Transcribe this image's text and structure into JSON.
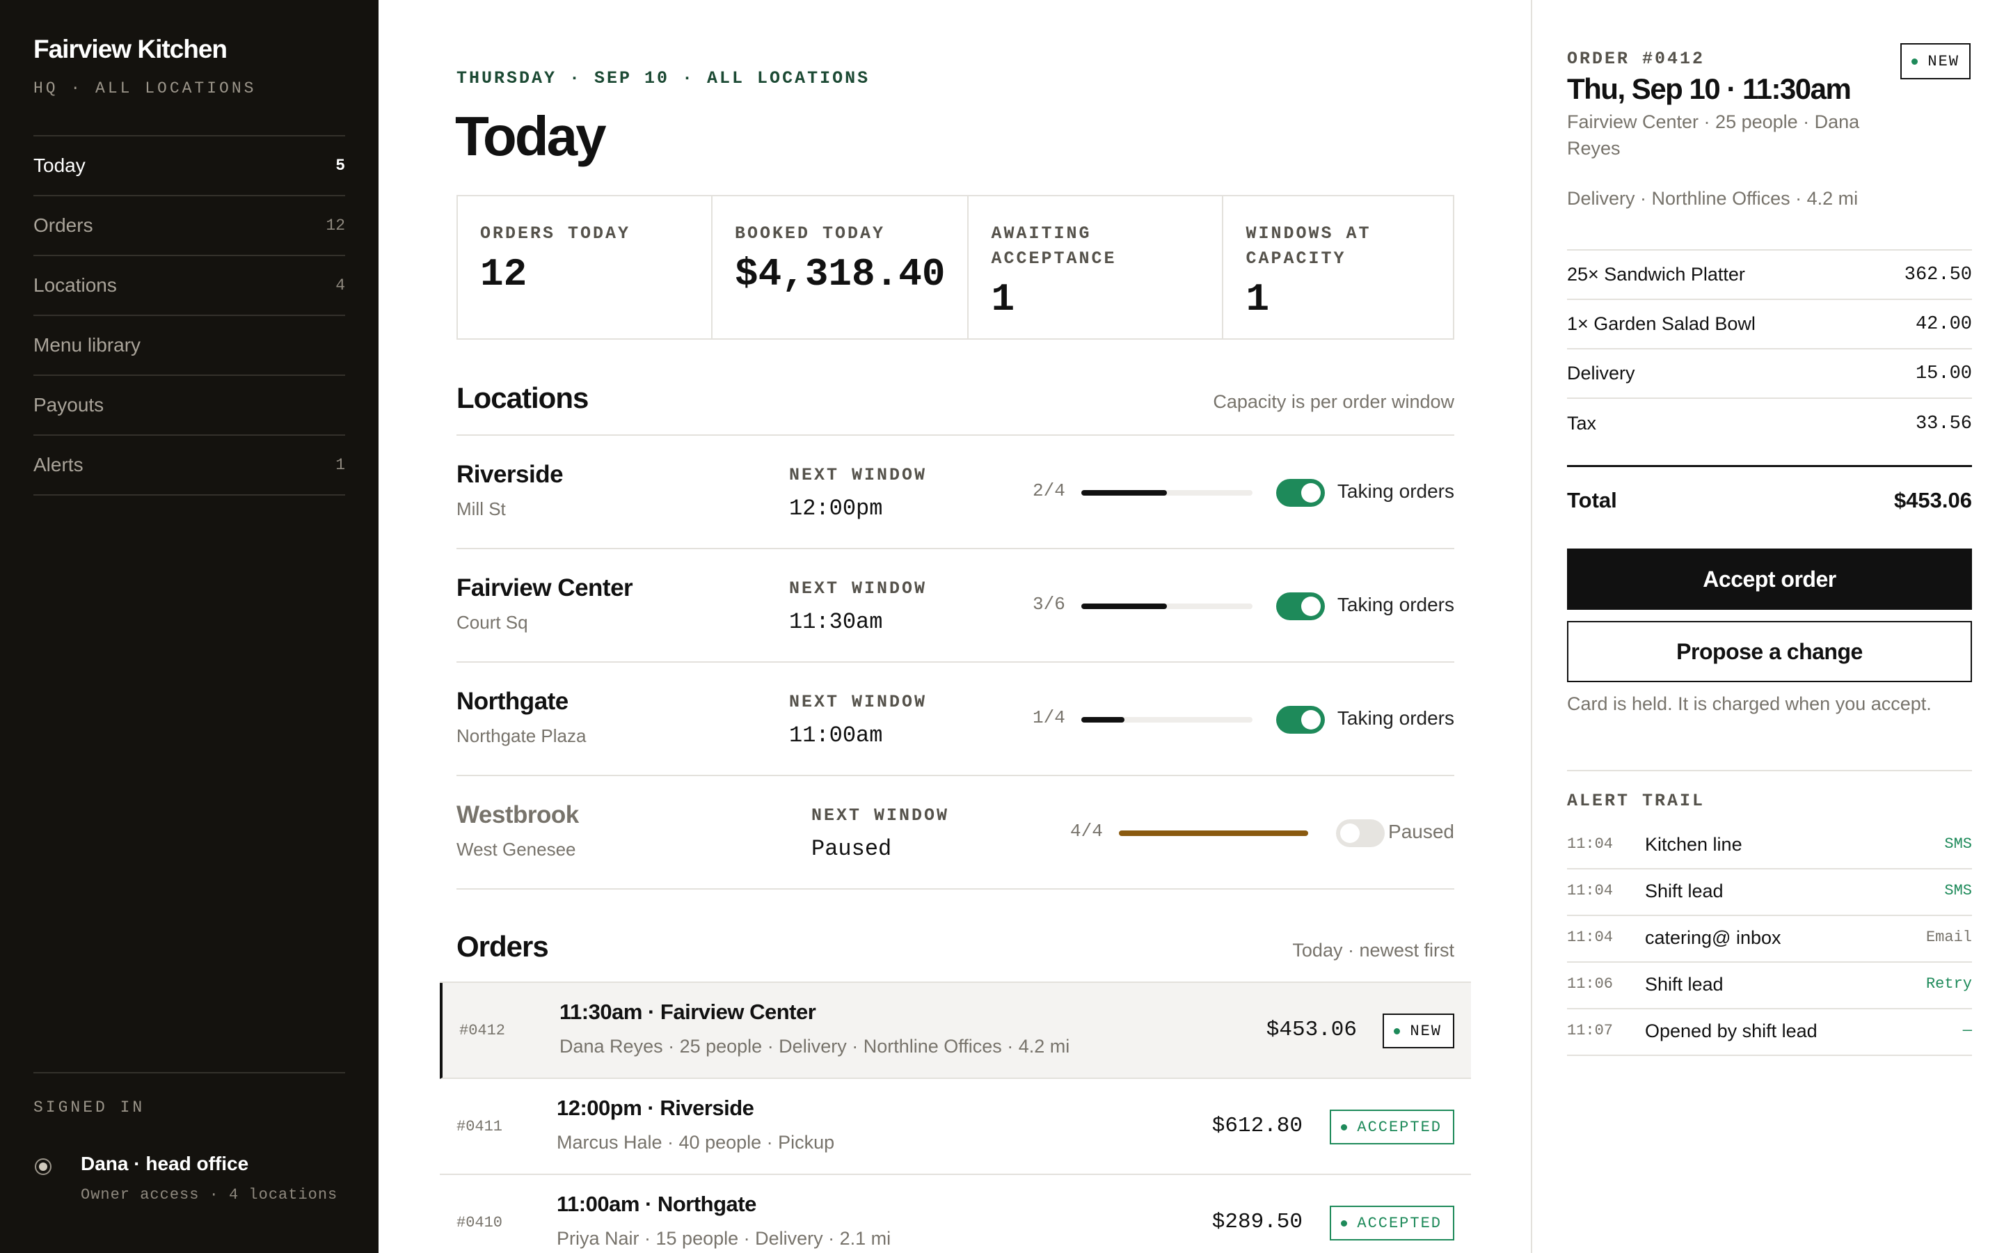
{
  "sidebar": {
    "brand": "Fairview Kitchen",
    "subtitle": "HQ · ALL LOCATIONS",
    "nav": [
      {
        "label": "Today",
        "count": "5"
      },
      {
        "label": "Orders",
        "count": "12"
      },
      {
        "label": "Locations",
        "count": "4"
      },
      {
        "label": "Menu library",
        "count": ""
      },
      {
        "label": "Payouts",
        "count": ""
      },
      {
        "label": "Alerts",
        "count": "1"
      }
    ],
    "signed_in_label": "SIGNED IN",
    "user_name": "Dana · head office",
    "user_sub": "Owner access · 4 locations"
  },
  "main": {
    "eyebrow": "THURSDAY · SEP 10 · ALL LOCATIONS",
    "title": "Today",
    "stats": [
      {
        "label": "ORDERS TODAY",
        "value": "12"
      },
      {
        "label": "BOOKED TODAY",
        "value": "$4,318.40"
      },
      {
        "label": "AWAITING ACCEPTANCE",
        "value": "1"
      },
      {
        "label": "WINDOWS AT CAPACITY",
        "value": "1"
      }
    ],
    "locations_title": "Locations",
    "locations_note": "Capacity is per order window",
    "next_window_label": "NEXT WINDOW",
    "locations": [
      {
        "name": "Riverside",
        "street": "Mill St",
        "next_window": "12:00pm",
        "ratio": "2/4",
        "fill": 0.5,
        "status": "Taking orders",
        "paused": false
      },
      {
        "name": "Fairview Center",
        "street": "Court Sq",
        "next_window": "11:30am",
        "ratio": "3/6",
        "fill": 0.5,
        "status": "Taking orders",
        "paused": false
      },
      {
        "name": "Northgate",
        "street": "Northgate Plaza",
        "next_window": "11:00am",
        "ratio": "1/4",
        "fill": 0.25,
        "status": "Taking orders",
        "paused": false
      },
      {
        "name": "Westbrook",
        "street": "West Genesee",
        "next_window": "Paused",
        "ratio": "4/4",
        "fill": 1.0,
        "status": "Paused",
        "paused": true
      }
    ],
    "orders_title": "Orders",
    "orders_note": "Today · newest first",
    "orders": [
      {
        "id": "#0412",
        "title": "11:30am · Fairview Center",
        "sub": "Dana Reyes · 25 people · Delivery · Northline Offices · 4.2 mi",
        "total": "$453.06",
        "badge": "NEW"
      },
      {
        "id": "#0411",
        "title": "12:00pm · Riverside",
        "sub": "Marcus Hale · 40 people · Pickup",
        "total": "$612.80",
        "badge": "ACCEPTED"
      },
      {
        "id": "#0410",
        "title": "11:00am · Northgate",
        "sub": "Priya Nair · 15 people · Delivery · 2.1 mi",
        "total": "$289.50",
        "badge": "ACCEPTED"
      }
    ]
  },
  "panel": {
    "eyebrow": "ORDER #0412",
    "badge": "NEW",
    "title": "Thu, Sep 10 · 11:30am",
    "sub": "Fairview Center · 25 people · Dana Reyes",
    "delivery": "Delivery · Northline Offices · 4.2 mi",
    "lines": [
      {
        "label": "25× Sandwich Platter",
        "amount": "362.50"
      },
      {
        "label": "1× Garden Salad Bowl",
        "amount": "42.00"
      },
      {
        "label": "Delivery",
        "amount": "15.00"
      },
      {
        "label": "Tax",
        "amount": "33.56"
      }
    ],
    "total_label": "Total",
    "total_value": "$453.06",
    "accept_label": "Accept order",
    "propose_label": "Propose a change",
    "note": "Card is held. It is charged when you accept.",
    "alert_title": "ALERT TRAIL",
    "alerts": [
      {
        "time": "11:04",
        "who": "Kitchen line",
        "channel": "SMS",
        "color": "#1e8a5a"
      },
      {
        "time": "11:04",
        "who": "Shift lead",
        "channel": "SMS",
        "color": "#1e8a5a"
      },
      {
        "time": "11:04",
        "who": "catering@ inbox",
        "channel": "Email",
        "color": "#77736b"
      },
      {
        "time": "11:06",
        "who": "Shift lead",
        "channel": "Retry",
        "color": "#1e8a5a"
      },
      {
        "time": "11:07",
        "who": "Opened by shift lead",
        "channel": "—",
        "color": "#1e8a5a"
      }
    ]
  }
}
